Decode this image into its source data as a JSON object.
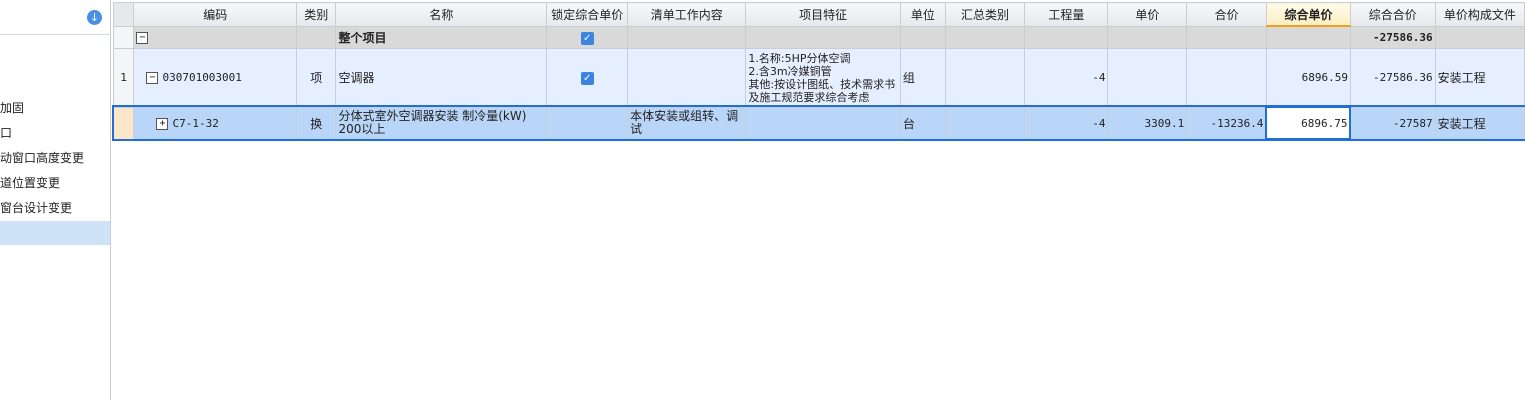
{
  "sidebar": {
    "download_icon": "download-icon",
    "items": [
      {
        "label": "加固"
      },
      {
        "label": "口"
      },
      {
        "label": "动窗口高度变更"
      },
      {
        "label": "道位置变更"
      },
      {
        "label": "窗台设计变更"
      },
      {
        "label": ""
      }
    ]
  },
  "table": {
    "headers": [
      "编码",
      "类别",
      "名称",
      "锁定综合单价",
      "清单工作内容",
      "项目特征",
      "单位",
      "汇总类别",
      "工程量",
      "单价",
      "合价",
      "综合单价",
      "综合合价",
      "单价构成文件"
    ],
    "active_header": "综合单价",
    "group_row": {
      "toggle": "−",
      "name": "整个项目",
      "locked": true,
      "total": "-27586.36"
    },
    "item_row": {
      "row_num": "1",
      "toggle": "−",
      "code": "030701003001",
      "type": "项",
      "name": "空调器",
      "locked": true,
      "feature": "1.名称:5HP分体空调\n2.含3m冷媒铜管\n其他:按设计图纸、技术需求书及施工规范要求综合考虑",
      "unit": "组",
      "qty": "-4",
      "comp_price": "6896.59",
      "comp_total": "-27586.36",
      "file": "安装工程"
    },
    "sub_row": {
      "toggle": "+",
      "code": "C7-1-32",
      "type": "换",
      "name": "分体式室外空调器安装 制冷量(kW) 200以上",
      "work": "本体安装或组转、调试",
      "unit": "台",
      "qty": "-4",
      "price": "3309.1",
      "total": "-13236.4",
      "comp_price": "6896.75",
      "comp_total": "-27587",
      "file": "安装工程"
    }
  }
}
